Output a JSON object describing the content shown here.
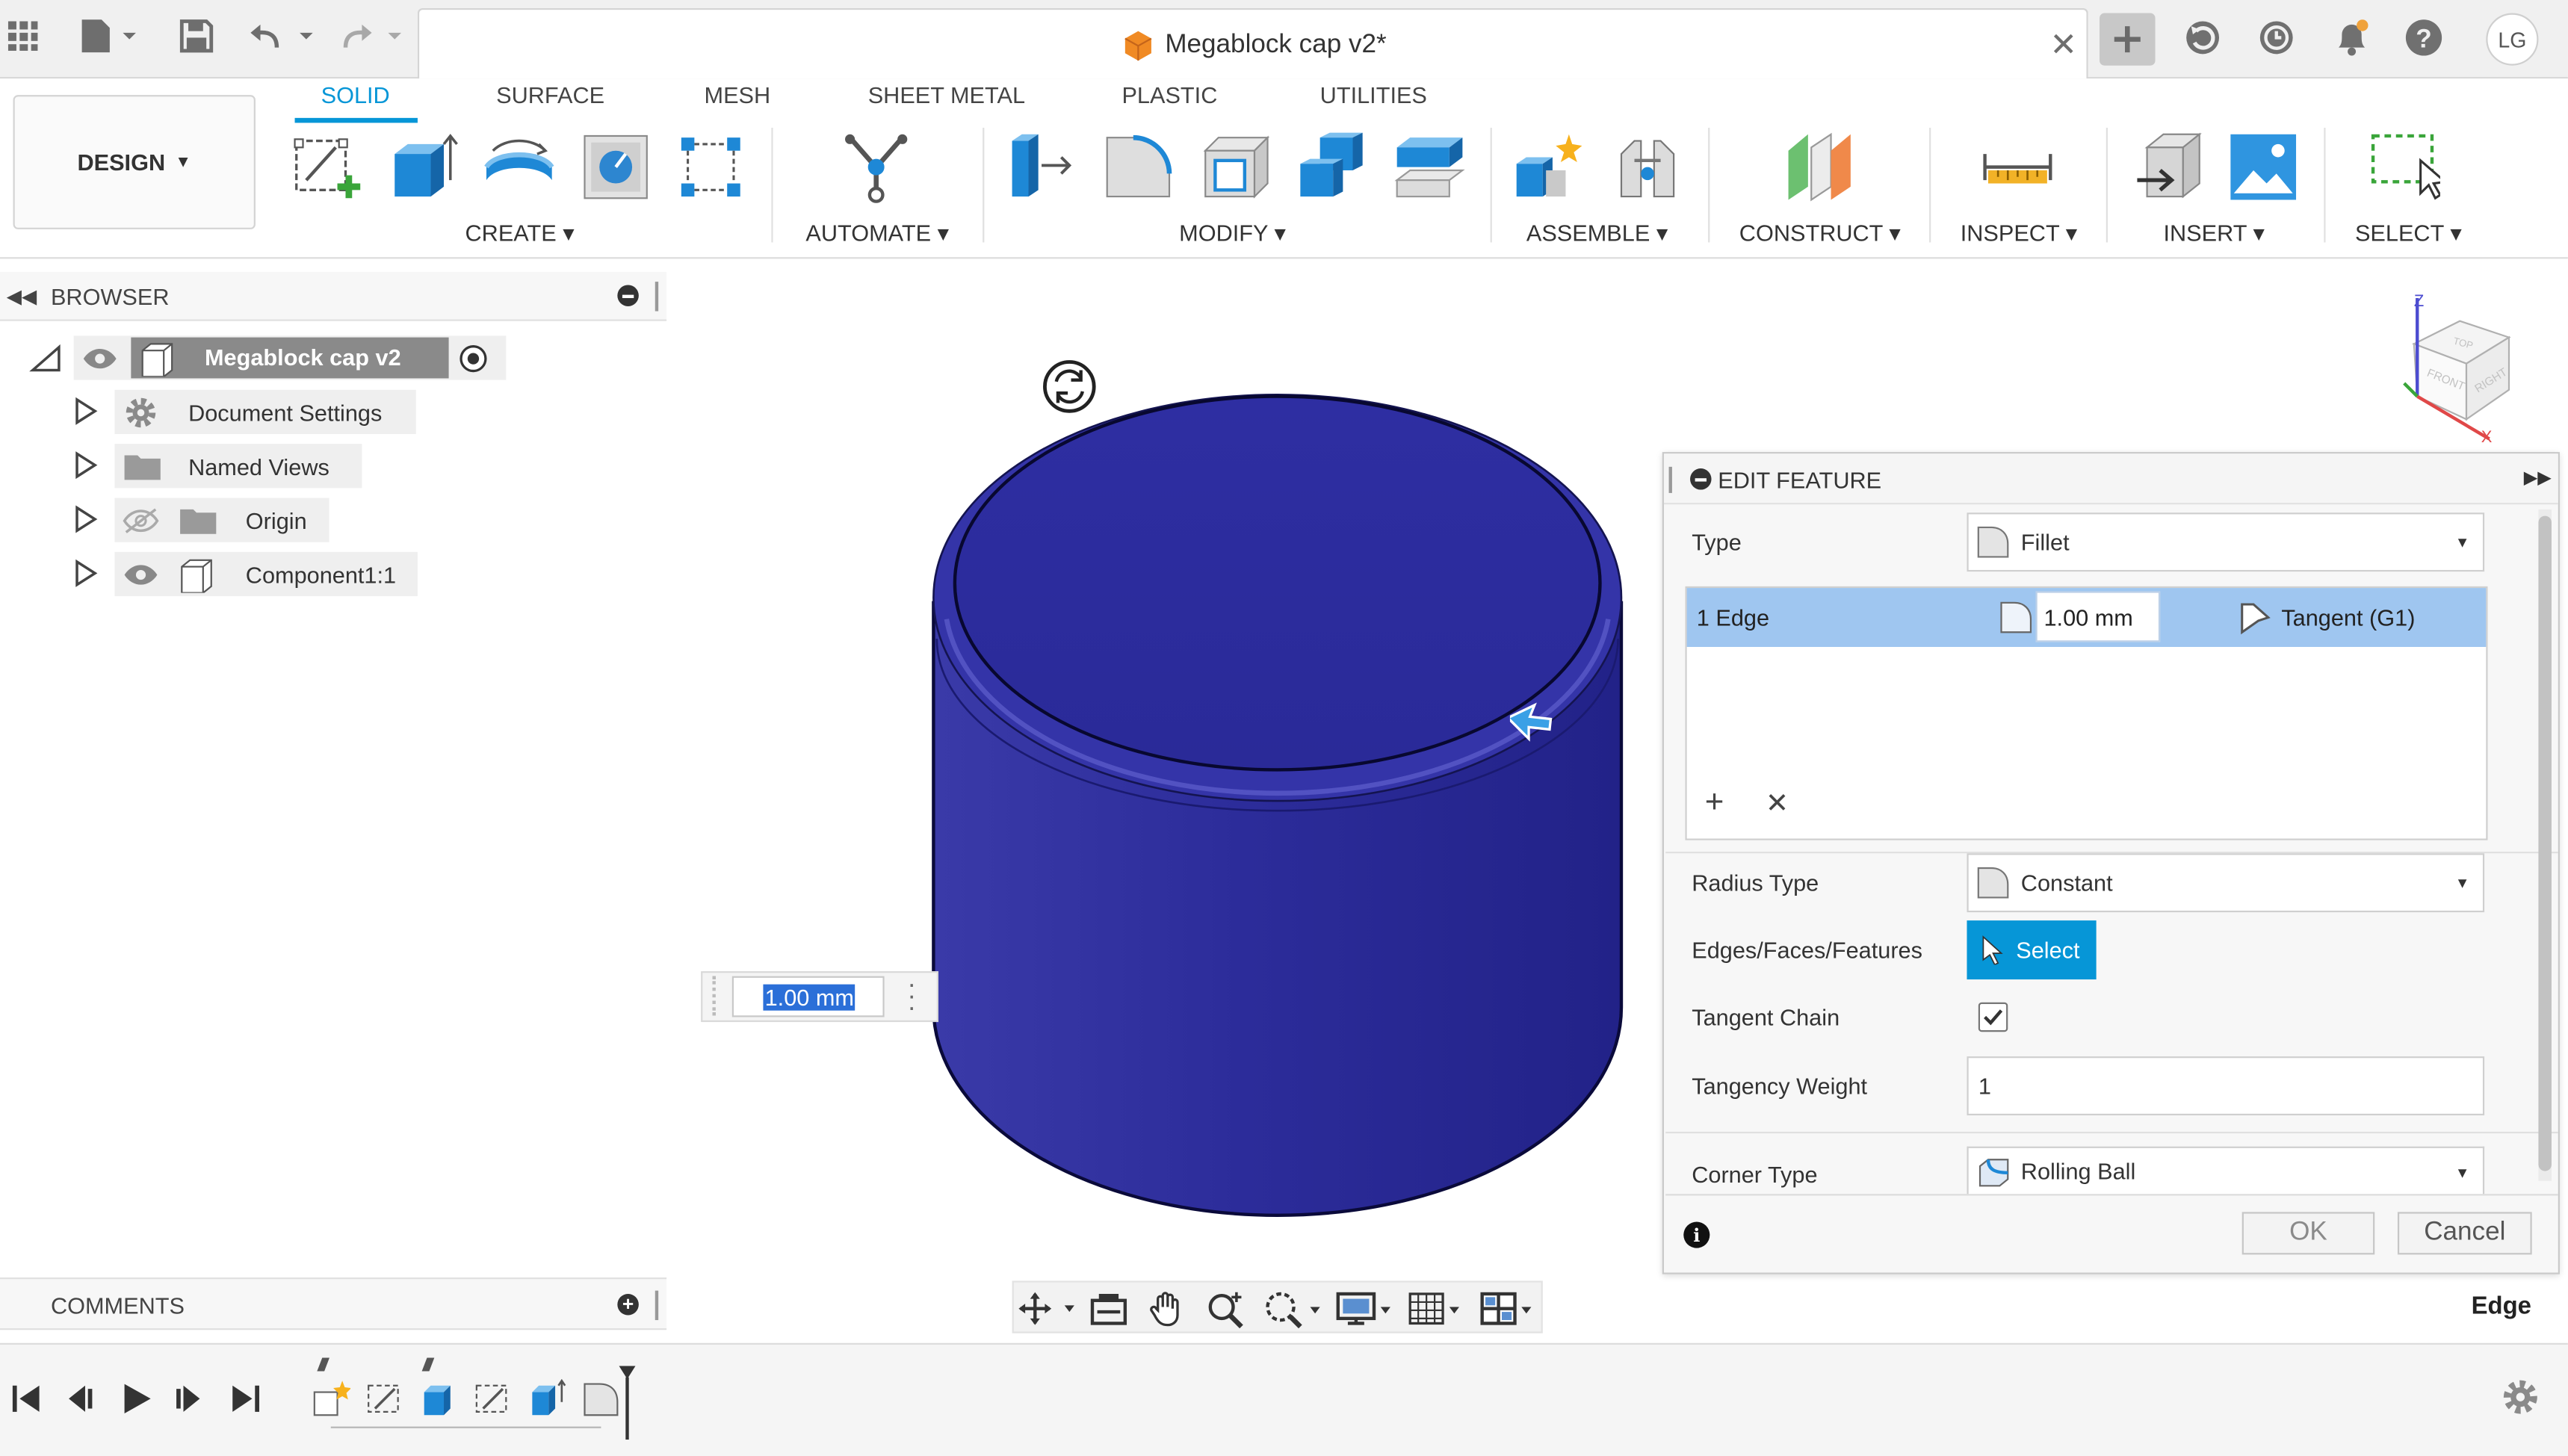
{
  "window": {
    "title": "Megablock cap v2*",
    "user_initials": "LG"
  },
  "ribbon": {
    "workspace": "DESIGN",
    "tabs": [
      {
        "label": "SOLID",
        "active": true
      },
      {
        "label": "SURFACE",
        "active": false
      },
      {
        "label": "MESH",
        "active": false
      },
      {
        "label": "SHEET METAL",
        "active": false
      },
      {
        "label": "PLASTIC",
        "active": false
      },
      {
        "label": "UTILITIES",
        "active": false
      }
    ],
    "groups": [
      "CREATE",
      "AUTOMATE",
      "MODIFY",
      "ASSEMBLE",
      "CONSTRUCT",
      "INSPECT",
      "INSERT",
      "SELECT"
    ]
  },
  "browser": {
    "header": "BROWSER",
    "root": "Megablock cap v2",
    "items": [
      "Document Settings",
      "Named Views",
      "Origin",
      "Component1:1"
    ]
  },
  "comments": {
    "label": "COMMENTS"
  },
  "viewport": {
    "dimension_value": "1.00 mm",
    "status": "Edge",
    "viewcube": {
      "top": "TOP",
      "front": "FRONT",
      "right": "RIGHT",
      "axis_z": "Z",
      "axis_x": "X"
    }
  },
  "edit_feature": {
    "title": "EDIT FEATURE",
    "type_label": "Type",
    "type_value": "Fillet",
    "selection_row": {
      "edges": "1 Edge",
      "radius": "1.00 mm",
      "continuity": "Tangent (G1)"
    },
    "radius_type_label": "Radius Type",
    "radius_type_value": "Constant",
    "edges_label": "Edges/Faces/Features",
    "select_button": "Select",
    "tangent_chain_label": "Tangent Chain",
    "tangent_chain_checked": true,
    "tangency_weight_label": "Tangency Weight",
    "tangency_weight_value": "1",
    "corner_type_label": "Corner Type",
    "corner_type_value": "Rolling Ball",
    "ok": "OK",
    "cancel": "Cancel"
  },
  "colors": {
    "accent": "#0696d7",
    "body": "#2c2c98",
    "selection_row": "#9fc6f0"
  }
}
